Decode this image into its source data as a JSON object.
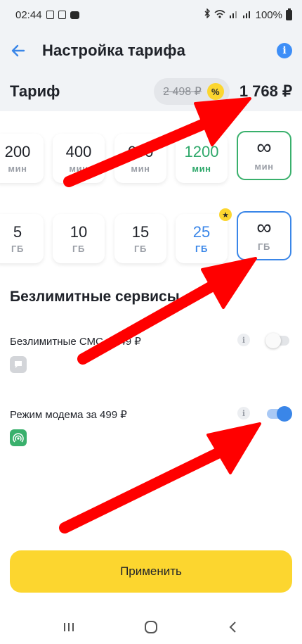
{
  "status_bar": {
    "time": "02:44",
    "battery_text": "100%"
  },
  "header": {
    "title": "Настройка тарифа",
    "info_icon": "info-icon"
  },
  "tariff": {
    "label": "Тариф",
    "old_price": "2 498 ₽",
    "discount_symbol": "%",
    "new_price": "1 768 ₽"
  },
  "minutes": [
    {
      "value": "200",
      "unit": "мин",
      "state": "normal"
    },
    {
      "value": "400",
      "unit": "мин",
      "state": "normal"
    },
    {
      "value": "600",
      "unit": "мин",
      "state": "normal"
    },
    {
      "value": "1200",
      "unit": "мин",
      "state": "highlight-green"
    },
    {
      "value": "∞",
      "unit": "мин",
      "state": "selected-green"
    }
  ],
  "gigabytes": [
    {
      "value": "5",
      "unit": "ГБ",
      "state": "normal"
    },
    {
      "value": "10",
      "unit": "ГБ",
      "state": "normal"
    },
    {
      "value": "15",
      "unit": "ГБ",
      "state": "normal"
    },
    {
      "value": "25",
      "unit": "ГБ",
      "state": "highlight-blue",
      "star": "★"
    },
    {
      "value": "∞",
      "unit": "ГБ",
      "state": "selected-blue"
    }
  ],
  "services": {
    "title": "Безлимитные сервисы",
    "items": [
      {
        "name": "Безлимитные СМС за 49 ₽",
        "enabled": false,
        "icon": "message-icon",
        "icon_color": "#d3d5d9"
      },
      {
        "name": "Режим модема за 499 ₽",
        "enabled": true,
        "icon": "hotspot-icon",
        "icon_color": "#39b06c"
      }
    ],
    "info_glyph": "i"
  },
  "apply_button": "Применить",
  "colors": {
    "accent_yellow": "#fcd62f",
    "accent_blue": "#3a86e8",
    "accent_green": "#39b06c",
    "annotation_red": "#ff0000"
  }
}
